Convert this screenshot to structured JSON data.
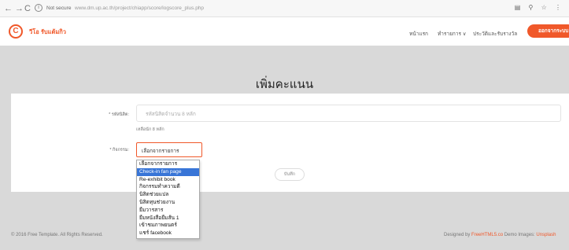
{
  "browser": {
    "security_label": "Not secure",
    "url": "www.dm.up.ac.th/project/chiapp/score/logscore_plus.php"
  },
  "header": {
    "logo_letter": "C",
    "site_name": "วีโอ รับแต้มกิว",
    "menu": [
      {
        "label": "หน้าแรก"
      },
      {
        "label": "ทำรายการ ∨"
      },
      {
        "label": "ประวัติและรับรางวัล"
      }
    ],
    "login_label": "ออกจากระบบ"
  },
  "form": {
    "title": "เพิ่มคะแนน",
    "student_id_label": "* รหัสนิสิต:",
    "student_id_placeholder": "รหัสนิสิตจำนวน 8 หลัก",
    "student_id_hint": "เหลือนัก 8 หลัก",
    "activity_label": "* กิจกรรม:",
    "activity_selected": "เลือกจากรายการ",
    "save_label": "บันทึก",
    "activity_options": [
      {
        "label": "เลือกจากรายการ",
        "highlighted": false
      },
      {
        "label": "Check-in fan page",
        "highlighted": true
      },
      {
        "label": "Re-exhibit book",
        "highlighted": false
      },
      {
        "label": "กิจกรรมทำความดี",
        "highlighted": false
      },
      {
        "label": "นิสิตช่วยแปล",
        "highlighted": false
      },
      {
        "label": "นิสิตทุนช่วยงาน",
        "highlighted": false
      },
      {
        "label": "ยืมวารสาร",
        "highlighted": false
      },
      {
        "label": "ยืมหนังสือยืมสั้น 1",
        "highlighted": false
      },
      {
        "label": "เข้าชมภาพยนตร์",
        "highlighted": false
      },
      {
        "label": "แชร์ facebook",
        "highlighted": false
      }
    ]
  },
  "footer": {
    "copyright": "© 2016 Free Template. All Rights Reserved.",
    "designed_by_prefix": "Designed by ",
    "designed_by_site": "FreeHTML5.co",
    "demo_images_prefix": " Demo Images: ",
    "demo_images_site": "Unsplash"
  },
  "colors": {
    "accent": "#f0582a",
    "main_background": "#d9d9d9",
    "dropdown_highlight": "#3875d7"
  }
}
